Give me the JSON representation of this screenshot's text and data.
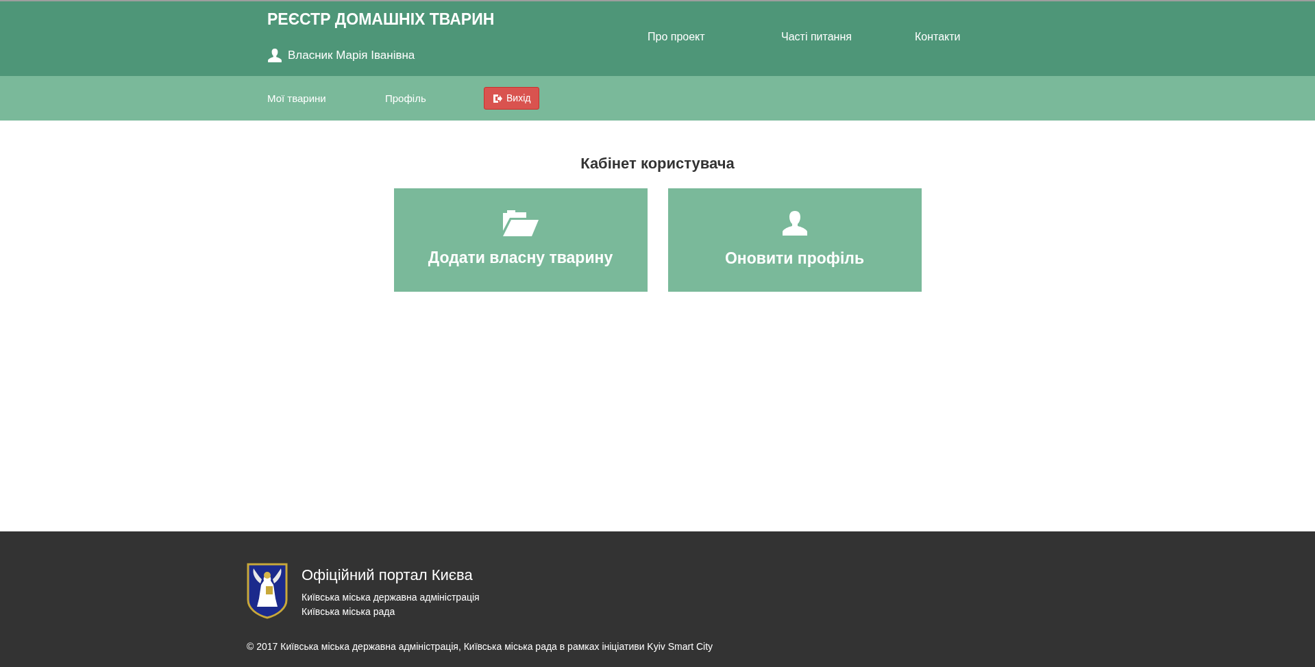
{
  "header": {
    "title": "РЕЄСТР ДОМАШНІХ ТВАРИН",
    "user": "Власник Марія Іванівна",
    "links": [
      "Про проект",
      "Часті питання",
      "Контакти"
    ]
  },
  "subnav": [
    {
      "kind": "link",
      "label": "Мої тварини"
    },
    {
      "kind": "link",
      "label": "Профіль"
    },
    {
      "kind": "logout",
      "label": "Вихід"
    }
  ],
  "main": {
    "heading": "Кабінет користувача",
    "cards": [
      {
        "kind": "folder",
        "label": "Додати власну тварину"
      },
      {
        "kind": "user",
        "label": "Оновити профіль"
      }
    ]
  },
  "footer": {
    "title": "Офіційний портал Києва",
    "lines": [
      "Київська міська державна адміністрація",
      "Київська міська рада"
    ],
    "copyright": "© 2017 Київська міська державна адміністрація, Київська міська рада в рамках ініціативи Kyiv Smart City"
  }
}
